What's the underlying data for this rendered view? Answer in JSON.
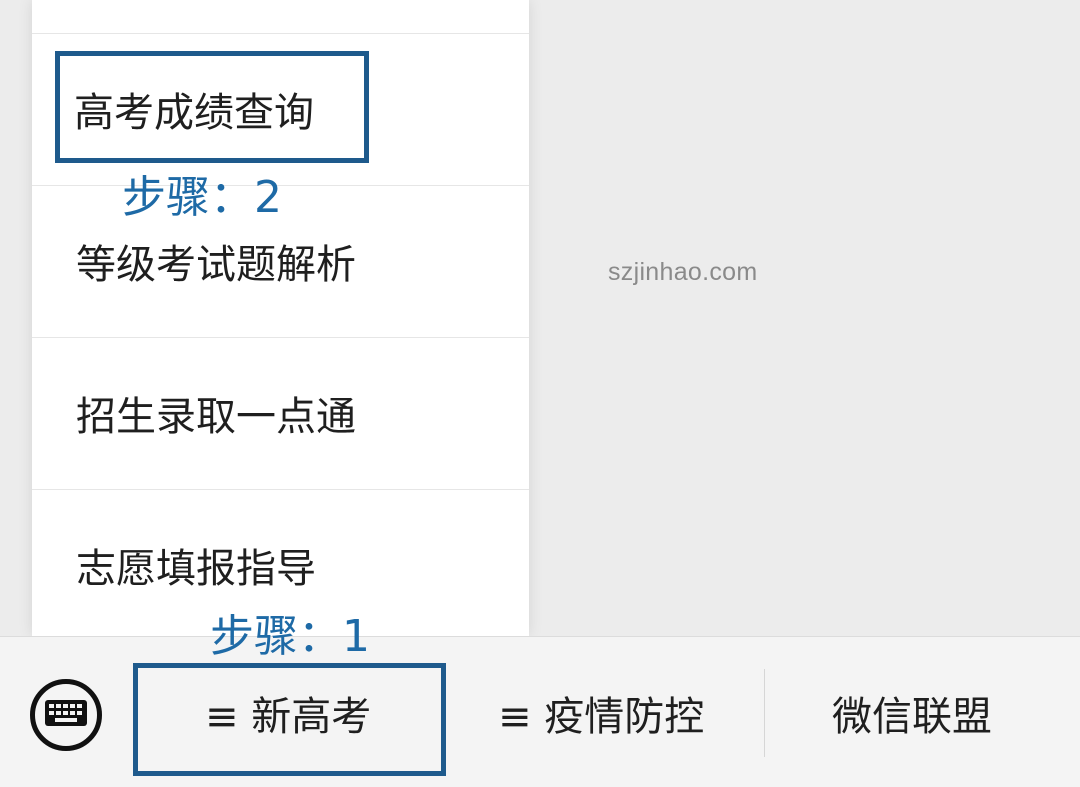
{
  "menu": {
    "items": [
      {
        "label": "高考成绩查询"
      },
      {
        "label": "等级考试题解析"
      },
      {
        "label": "招生录取一点通"
      },
      {
        "label": "志愿填报指导"
      }
    ]
  },
  "annotations": {
    "step2": "步骤：2",
    "step1": "步骤：1"
  },
  "watermark": "szjinhao.com",
  "bottom_bar": {
    "keyboard_icon": "keyboard-icon",
    "tabs": [
      {
        "label": "≡ 新高考"
      },
      {
        "label": "≡ 疫情防控"
      },
      {
        "label": "微信联盟"
      }
    ]
  },
  "colors": {
    "highlight": "#1e5a8c",
    "step_text": "#1e6aa6"
  }
}
